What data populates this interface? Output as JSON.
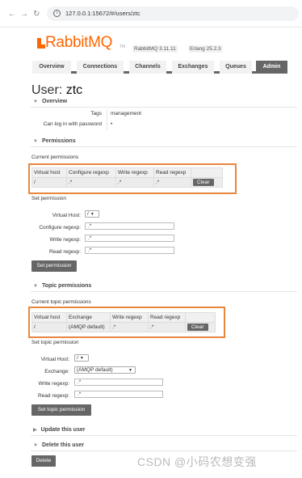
{
  "browser": {
    "url": "127.0.0.1:15672/#/users/ztc",
    "back_icon": "←",
    "forward_icon": "→",
    "reload_icon": "↻",
    "info_icon": "i"
  },
  "header": {
    "logo": "RabbitMQ",
    "tm": "TM",
    "rabbit_version": "RabbitMQ 3.11.11",
    "erlang_version": "Erlang 25.2.3"
  },
  "tabs": [
    "Overview",
    "Connections",
    "Channels",
    "Exchanges",
    "Queues",
    "Admin"
  ],
  "page": {
    "title_prefix": "User:",
    "username": "ztc"
  },
  "overview": {
    "heading": "Overview",
    "tags_label": "Tags",
    "tags_value": "management",
    "login_label": "Can log in with password",
    "login_value": "•"
  },
  "permissions": {
    "heading": "Permissions",
    "current_label": "Current permissions",
    "columns": [
      "Virtual host",
      "Configure regexp",
      "Write regexp",
      "Read regexp"
    ],
    "row": {
      "vhost": "/",
      "configure": ".*",
      "write": ".*",
      "read": ".*"
    },
    "clear_label": "Clear",
    "set_label": "Set permission",
    "vhost_label": "Virtual Host:",
    "vhost_value": "/",
    "configure_label": "Configure regexp:",
    "configure_value": ".*",
    "write_label": "Write regexp:",
    "write_value": ".*",
    "read_label": "Read regexp:",
    "read_value": ".*",
    "button": "Set permission"
  },
  "topic": {
    "heading": "Topic permissions",
    "current_label": "Current topic permissions",
    "columns": [
      "Virtual host",
      "Exchange",
      "Write regexp",
      "Read regexp"
    ],
    "row": {
      "vhost": "/",
      "exchange": "(AMQP default)",
      "write": ".*",
      "read": ".*"
    },
    "clear_label": "Clear",
    "set_label": "Set topic permission",
    "vhost_label": "Virtual Host:",
    "vhost_value": "/",
    "exchange_label": "Exchange:",
    "exchange_value": "(AMQP default)",
    "write_label": "Write regexp:",
    "write_value": ".*",
    "read_label": "Read regexp:",
    "read_value": ".*",
    "button": "Set topic permission"
  },
  "update": {
    "heading": "Update this user"
  },
  "delete": {
    "heading": "Delete this user",
    "button": "Delete"
  },
  "watermark": "CSDN @小码农想变强",
  "colors": {
    "brand": "#ff6600",
    "highlight": "#e8863f",
    "button": "#666666"
  }
}
